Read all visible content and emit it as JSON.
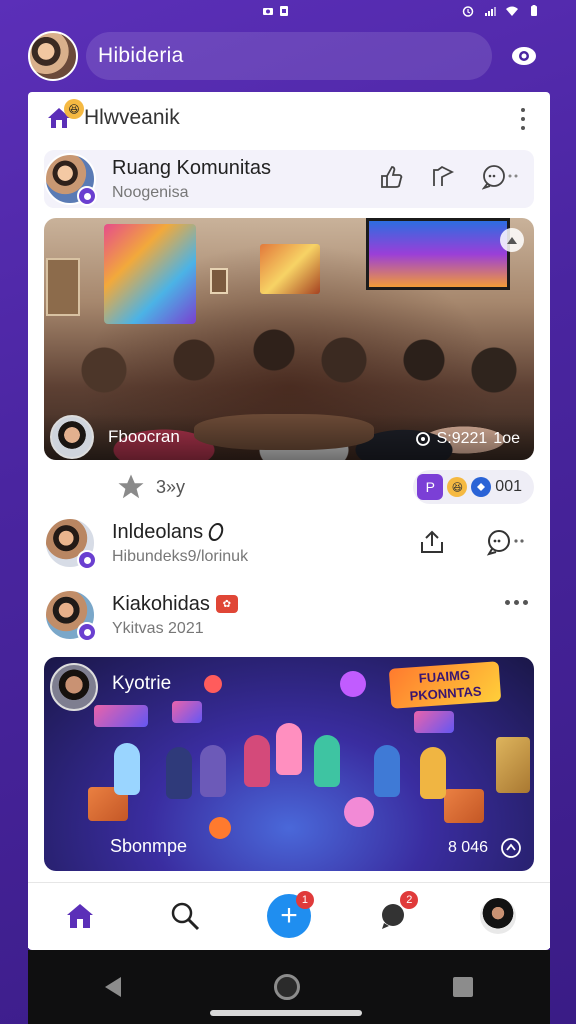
{
  "status_bar": {
    "left_icons": [
      "camera-icon",
      "sim-icon"
    ],
    "right_icons": [
      "alarm-icon",
      "signal-icon",
      "wifi-icon",
      "battery-icon"
    ]
  },
  "top_bar": {
    "search_placeholder": "Hibideria",
    "right_icon": "eye-icon"
  },
  "header": {
    "title": "Hlwveanik"
  },
  "community_card": {
    "name": "Ruang Komunitas",
    "subtitle": "Noogenisa"
  },
  "image_post": {
    "caption": "Fboocran",
    "stats": "S:9221",
    "stats_suffix": "1oe"
  },
  "reactions": {
    "star_count": "3»y",
    "letter": "P",
    "count": "001"
  },
  "posts": [
    {
      "name": "Inldeolans",
      "subtitle": "Hibundeks9/lorinuk"
    },
    {
      "name": "Kiakohidas",
      "subtitle": "Ykitvas 2021"
    }
  ],
  "game_card": {
    "title": "Kyotrie",
    "banner_line1": "FUAIMG",
    "banner_line2": "PKONNTAS",
    "bottom_left": "Sbonmpe",
    "bottom_right": "8 046"
  },
  "bottom_nav": {
    "add_badge": "1",
    "chat_badge": "2"
  },
  "colors": {
    "accent_purple": "#5b2fb8",
    "accent_blue": "#1f8ef0",
    "badge_red": "#e03a3a"
  }
}
